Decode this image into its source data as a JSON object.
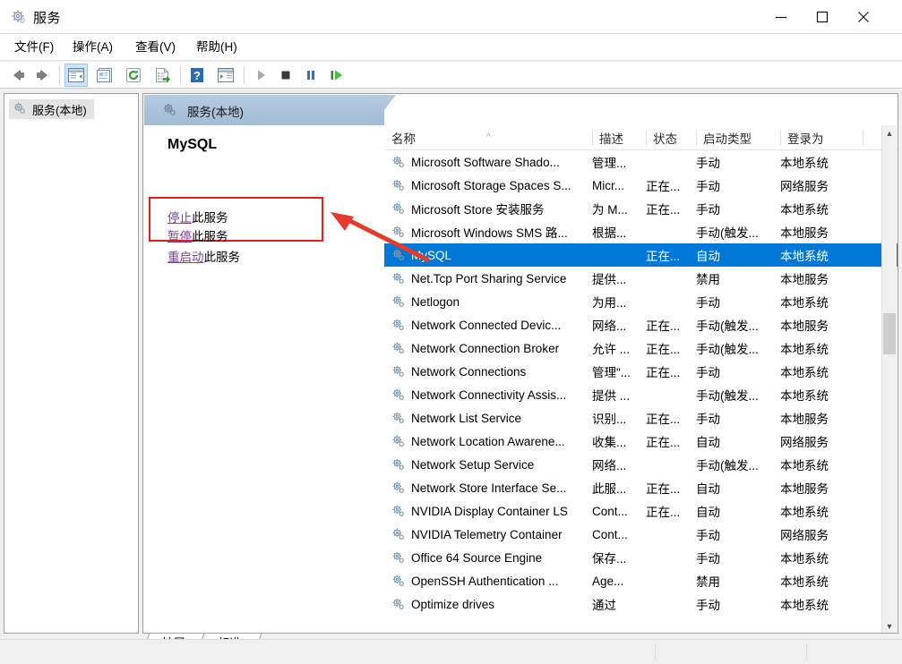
{
  "window": {
    "title": "服务",
    "icon": "services-gear-icon",
    "controls": {
      "minimize": "minimize-icon",
      "maximize": "maximize-icon",
      "close": "close-icon"
    }
  },
  "menubar": [
    {
      "id": "file",
      "label": "文件(F)"
    },
    {
      "id": "action",
      "label": "操作(A)"
    },
    {
      "id": "view",
      "label": "查看(V)"
    },
    {
      "id": "help",
      "label": "帮助(H)"
    }
  ],
  "toolbar": [
    {
      "id": "back",
      "icon": "back-arrow-icon",
      "enabled": true
    },
    {
      "id": "forward",
      "icon": "forward-arrow-icon",
      "enabled": true
    },
    {
      "id": "show-hide-tree",
      "icon": "show-console-tree-icon",
      "enabled": true,
      "pressed": true
    },
    {
      "id": "properties",
      "icon": "properties-icon",
      "enabled": true
    },
    {
      "id": "refresh",
      "icon": "refresh-icon",
      "enabled": true
    },
    {
      "id": "export-list",
      "icon": "export-list-icon",
      "enabled": true
    },
    {
      "id": "help",
      "icon": "help-question-icon",
      "enabled": true
    },
    {
      "id": "show-action-pane",
      "icon": "show-action-pane-icon",
      "enabled": true
    },
    {
      "id": "start",
      "icon": "start-service-icon",
      "enabled": false
    },
    {
      "id": "stop",
      "icon": "stop-service-icon",
      "enabled": true
    },
    {
      "id": "pause",
      "icon": "pause-service-icon",
      "enabled": true
    },
    {
      "id": "restart",
      "icon": "restart-service-icon",
      "enabled": true
    }
  ],
  "sidebar": {
    "items": [
      {
        "id": "services-local",
        "label": "服务(本地)",
        "icon": "services-node-icon",
        "selected": true
      }
    ]
  },
  "right_pane": {
    "header": {
      "label": "服务(本地)",
      "icon": "services-node-icon"
    },
    "detail": {
      "service_name": "MySQL",
      "links": [
        {
          "id": "stop",
          "link_text": "停止",
          "suffix": "此服务"
        },
        {
          "id": "pause",
          "link_text": "暂停",
          "suffix": "此服务"
        },
        {
          "id": "restart",
          "link_text": "重启动",
          "suffix": "此服务"
        }
      ],
      "highlight_color": "#e02020"
    }
  },
  "list": {
    "columns": [
      {
        "id": "name",
        "label": "名称",
        "sorted": true,
        "sort_dir": "asc"
      },
      {
        "id": "description",
        "label": "描述"
      },
      {
        "id": "status",
        "label": "状态"
      },
      {
        "id": "startup",
        "label": "启动类型"
      },
      {
        "id": "logon",
        "label": "登录为"
      }
    ],
    "selection_color": "#0078d7",
    "rows": [
      {
        "name": "Microsoft Software Shado...",
        "description": "管理...",
        "status": "",
        "startup": "手动",
        "logon": "本地系统",
        "selected": false
      },
      {
        "name": "Microsoft Storage Spaces S...",
        "description": "Micr...",
        "status": "正在...",
        "startup": "手动",
        "logon": "网络服务",
        "selected": false
      },
      {
        "name": "Microsoft Store 安装服务",
        "description": "为 M...",
        "status": "正在...",
        "startup": "手动",
        "logon": "本地系统",
        "selected": false
      },
      {
        "name": "Microsoft Windows SMS 路...",
        "description": "根据...",
        "status": "",
        "startup": "手动(触发...",
        "logon": "本地服务",
        "selected": false
      },
      {
        "name": "MySQL",
        "description": "",
        "status": "正在...",
        "startup": "自动",
        "logon": "本地系统",
        "selected": true
      },
      {
        "name": "Net.Tcp Port Sharing Service",
        "description": "提供...",
        "status": "",
        "startup": "禁用",
        "logon": "本地服务",
        "selected": false
      },
      {
        "name": "Netlogon",
        "description": "为用...",
        "status": "",
        "startup": "手动",
        "logon": "本地系统",
        "selected": false
      },
      {
        "name": "Network Connected Devic...",
        "description": "网络...",
        "status": "正在...",
        "startup": "手动(触发...",
        "logon": "本地服务",
        "selected": false
      },
      {
        "name": "Network Connection Broker",
        "description": "允许 ...",
        "status": "正在...",
        "startup": "手动(触发...",
        "logon": "本地系统",
        "selected": false
      },
      {
        "name": "Network Connections",
        "description": "管理\"...",
        "status": "正在...",
        "startup": "手动",
        "logon": "本地系统",
        "selected": false
      },
      {
        "name": "Network Connectivity Assis...",
        "description": "提供 ...",
        "status": "",
        "startup": "手动(触发...",
        "logon": "本地系统",
        "selected": false
      },
      {
        "name": "Network List Service",
        "description": "识别...",
        "status": "正在...",
        "startup": "手动",
        "logon": "本地服务",
        "selected": false
      },
      {
        "name": "Network Location Awarene...",
        "description": "收集...",
        "status": "正在...",
        "startup": "自动",
        "logon": "网络服务",
        "selected": false
      },
      {
        "name": "Network Setup Service",
        "description": "网络...",
        "status": "",
        "startup": "手动(触发...",
        "logon": "本地系统",
        "selected": false
      },
      {
        "name": "Network Store Interface Se...",
        "description": "此服...",
        "status": "正在...",
        "startup": "自动",
        "logon": "本地服务",
        "selected": false
      },
      {
        "name": "NVIDIA Display Container LS",
        "description": "Cont...",
        "status": "正在...",
        "startup": "自动",
        "logon": "本地系统",
        "selected": false
      },
      {
        "name": "NVIDIA Telemetry Container",
        "description": "Cont...",
        "status": "",
        "startup": "手动",
        "logon": "网络服务",
        "selected": false
      },
      {
        "name": "Office 64 Source Engine",
        "description": "保存...",
        "status": "",
        "startup": "手动",
        "logon": "本地系统",
        "selected": false
      },
      {
        "name": "OpenSSH Authentication ...",
        "description": "Age...",
        "status": "",
        "startup": "禁用",
        "logon": "本地系统",
        "selected": false
      },
      {
        "name": "Optimize drives",
        "description": "通过",
        "status": "",
        "startup": "手动",
        "logon": "本地系统",
        "selected": false
      }
    ],
    "scrollbar": {
      "up": "chevron-up-icon",
      "down": "chevron-down-icon"
    }
  },
  "tabs": [
    {
      "id": "extended",
      "label": "扩展",
      "active": false
    },
    {
      "id": "standard",
      "label": "标准",
      "active": true
    }
  ],
  "statusbar": {
    "left": "",
    "middle": "",
    "right": ""
  }
}
